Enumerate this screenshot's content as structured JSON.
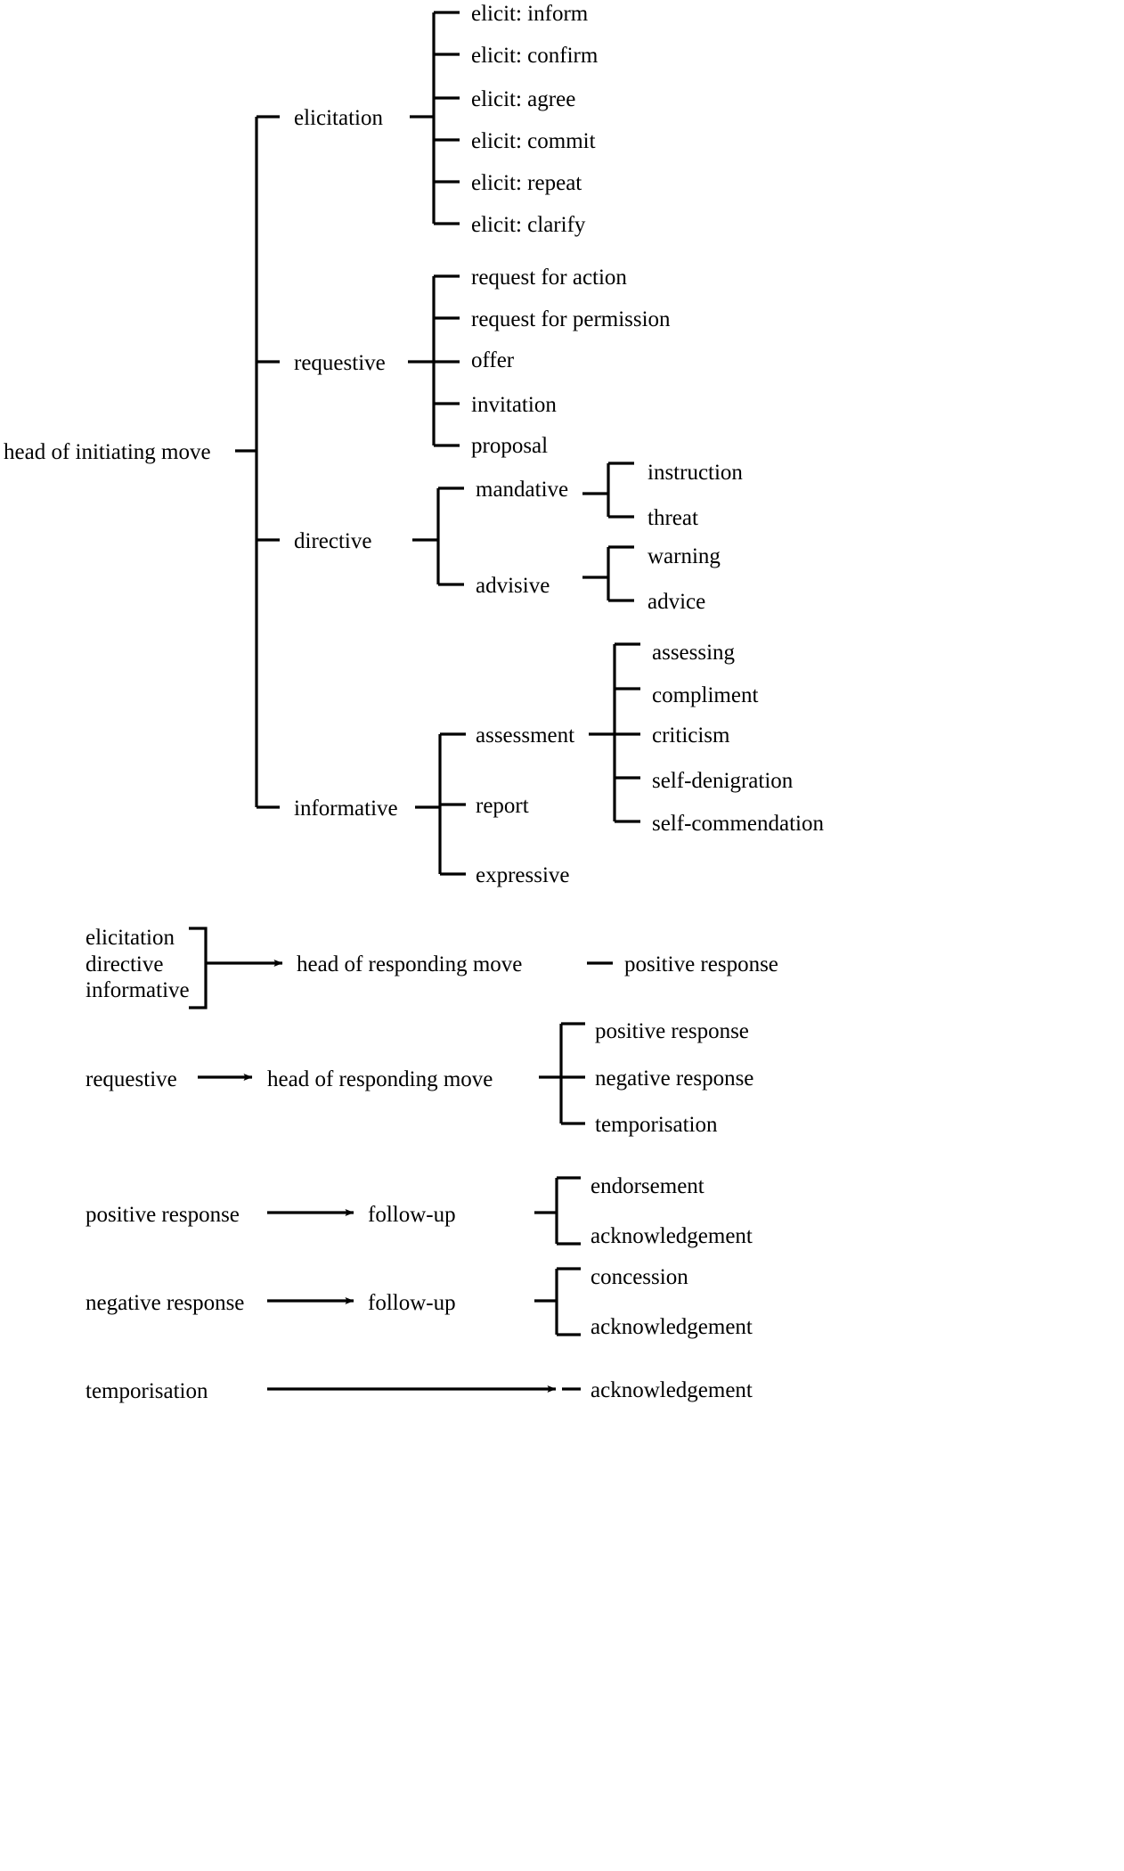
{
  "figure": {
    "type": "tree-taxonomy-diagram",
    "background_color": "#ffffff",
    "line_color": "#000000",
    "text_color": "#000000"
  },
  "initiating": {
    "root": "head of initiating move",
    "branches": [
      {
        "label": "elicitation",
        "children": [
          {
            "label": "elicit: inform"
          },
          {
            "label": "elicit: confirm"
          },
          {
            "label": "elicit: agree"
          },
          {
            "label": "elicit: commit"
          },
          {
            "label": "elicit: repeat"
          },
          {
            "label": "elicit: clarify"
          }
        ]
      },
      {
        "label": "requestive",
        "children": [
          {
            "label": "request for action"
          },
          {
            "label": "request for permission"
          },
          {
            "label": "offer"
          },
          {
            "label": "invitation"
          },
          {
            "label": "proposal"
          }
        ]
      },
      {
        "label": "directive",
        "children": [
          {
            "label": "mandative",
            "children": [
              {
                "label": "instruction"
              },
              {
                "label": "threat"
              }
            ]
          },
          {
            "label": "advisive",
            "children": [
              {
                "label": "warning"
              },
              {
                "label": "advice"
              }
            ]
          }
        ]
      },
      {
        "label": "informative",
        "children": [
          {
            "label": "assessment",
            "children": [
              {
                "label": "assessing"
              },
              {
                "label": "compliment"
              },
              {
                "label": "criticism"
              },
              {
                "label": "self-denigration"
              },
              {
                "label": "self-commendation"
              }
            ]
          },
          {
            "label": "report"
          },
          {
            "label": "expressive"
          }
        ]
      }
    ]
  },
  "responding": [
    {
      "sources": [
        "elicitation",
        "directive",
        "informative"
      ],
      "target": "head of responding move",
      "outcomes": [
        "positive response"
      ]
    },
    {
      "sources": [
        "requestive"
      ],
      "target": "head of responding move",
      "outcomes": [
        "positive response",
        "negative response",
        "temporisation"
      ]
    }
  ],
  "followups": [
    {
      "source": "positive response",
      "target": "follow-up",
      "outcomes": [
        "endorsement",
        "acknowledgement"
      ]
    },
    {
      "source": "negative response",
      "target": "follow-up",
      "outcomes": [
        "concession",
        "acknowledgement"
      ]
    },
    {
      "source": "temporisation",
      "target": "",
      "outcomes": [
        "acknowledgement"
      ]
    }
  ],
  "labels": {
    "l_root": "head of initiating move",
    "l_elicitation": "elicitation",
    "l_requestive": "requestive",
    "l_directive": "directive",
    "l_informative": "informative",
    "l_elicit_inform": "elicit: inform",
    "l_elicit_confirm": "elicit: confirm",
    "l_elicit_agree": "elicit: agree",
    "l_elicit_commit": "elicit: commit",
    "l_elicit_repeat": "elicit: repeat",
    "l_elicit_clarify": "elicit: clarify",
    "l_req_action": "request for action",
    "l_req_permission": "request for permission",
    "l_offer": "offer",
    "l_invitation": "invitation",
    "l_proposal": "proposal",
    "l_mandative": "mandative",
    "l_advisive": "advisive",
    "l_instruction": "instruction",
    "l_threat": "threat",
    "l_warning": "warning",
    "l_advice": "advice",
    "l_assessment": "assessment",
    "l_report": "report",
    "l_expressive": "expressive",
    "l_assessing": "assessing",
    "l_compliment": "compliment",
    "l_criticism": "criticism",
    "l_self_denigration": "self-denigration",
    "l_self_commendation": "self-commendation",
    "l_elicitation2": "elicitation",
    "l_directive2": "directive",
    "l_informative2": "informative",
    "l_head_resp_1": "head of responding move",
    "l_positive_1": "positive response",
    "l_requestive2": "requestive",
    "l_head_resp_2": "head of responding move",
    "l_positive_2": "positive response",
    "l_negative_2": "negative response",
    "l_temporisation_2": "temporisation",
    "l_positive_3": "positive response",
    "l_followup_1": "follow-up",
    "l_endorsement": "endorsement",
    "l_acknowledgement_1": "acknowledgement",
    "l_negative_3": "negative response",
    "l_followup_2": "follow-up",
    "l_concession": "concession",
    "l_acknowledgement_2": "acknowledgement",
    "l_temporisation_3": "temporisation",
    "l_acknowledgement_3": "acknowledgement"
  }
}
